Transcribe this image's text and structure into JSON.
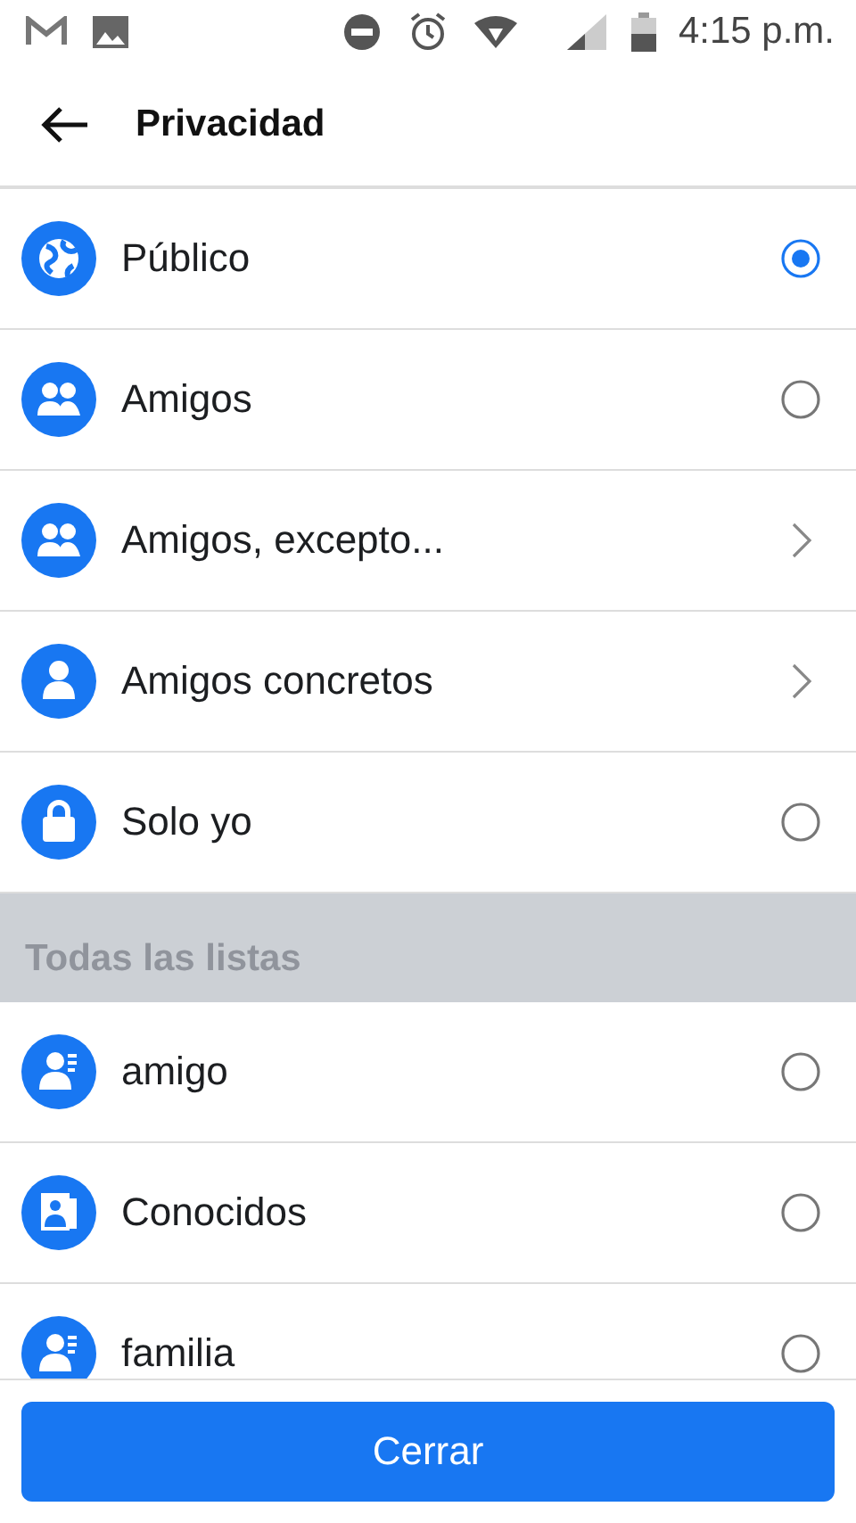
{
  "status_bar": {
    "time": "4:15 p.m."
  },
  "header": {
    "title": "Privacidad"
  },
  "options": [
    {
      "label": "Público",
      "kind": "radio",
      "selected": true
    },
    {
      "label": "Amigos",
      "kind": "radio",
      "selected": false
    },
    {
      "label": "Amigos, excepto...",
      "kind": "chevron"
    },
    {
      "label": "Amigos concretos",
      "kind": "chevron"
    },
    {
      "label": "Solo yo",
      "kind": "radio",
      "selected": false
    }
  ],
  "section": {
    "title": "Todas las listas"
  },
  "lists": [
    {
      "label": "amigo",
      "kind": "radio",
      "selected": false
    },
    {
      "label": "Conocidos",
      "kind": "radio",
      "selected": false
    },
    {
      "label": "familia",
      "kind": "radio",
      "selected": false
    }
  ],
  "footer": {
    "button": "Cerrar"
  }
}
